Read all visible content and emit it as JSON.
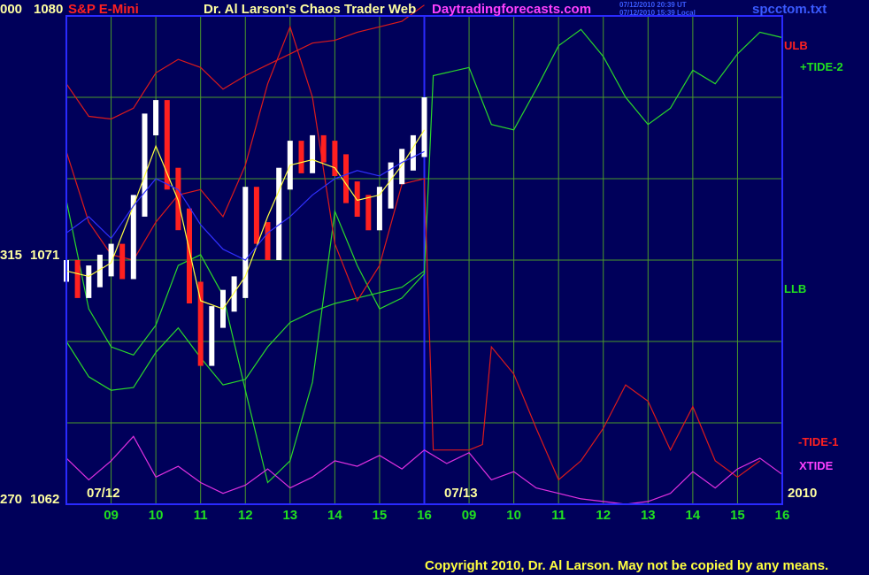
{
  "header": {
    "instrument": "S&P E-Mini",
    "title": "Dr. Al Larson's Chaos Trader Web",
    "site": "Daytradingforecasts.com",
    "timestamp_ut": "07/12/2010 20:39 UT",
    "timestamp_local": "07/12/2010 15:39 Local",
    "filename": "spcctom.txt"
  },
  "y_axis": {
    "top_left": "000",
    "top_price": "1080",
    "mid_left": "315",
    "mid_price": "1071",
    "bottom_left": "270",
    "bottom_price": "1062"
  },
  "right_labels": {
    "ulb": "ULB",
    "tide2": "+TIDE-2",
    "llb": "LLB",
    "tide1": "-TIDE-1",
    "xtide": "XTIDE"
  },
  "date_labels": {
    "d1": "07/12",
    "d2": "07/13",
    "year": "2010"
  },
  "footer": {
    "copyright": "Copyright 2010, Dr. Al Larson. May not be copied by any means."
  },
  "colors": {
    "background": "#00005a",
    "grid": "#4a9a2a",
    "frame": "#2a2aff",
    "ulb": "#dd1a1a",
    "tide2": "#2ad82a",
    "xtide": "#e030e0",
    "bar_up": "#ffffff",
    "bar_down": "#ff2020",
    "ma": "#ffff40",
    "ma_slow": "#3030ff",
    "label_cream": "#ffffa0",
    "label_green": "#20e020",
    "label_red": "#ff2020",
    "label_magenta": "#ff40ff",
    "label_blue": "#3a5aff"
  },
  "chart_data": {
    "type": "line",
    "title": "Dr. Al Larson's Chaos Trader Web",
    "ylim": [
      1062,
      1080
    ],
    "y_ticks": [
      1062,
      1071,
      1080
    ],
    "x_days": [
      "07/12",
      "07/13"
    ],
    "x_ticks": [
      "09",
      "10",
      "11",
      "12",
      "13",
      "14",
      "15",
      "16",
      "09",
      "10",
      "11",
      "12",
      "13",
      "14",
      "15",
      "16"
    ],
    "grid": true,
    "price_bars": {
      "x_hours": [
        8.0,
        8.25,
        8.5,
        8.75,
        9.0,
        9.25,
        9.5,
        9.75,
        10.0,
        10.25,
        10.5,
        10.75,
        11.0,
        11.25,
        11.5,
        11.75,
        12.0,
        12.25,
        12.5,
        12.75,
        13.0,
        13.25,
        13.5,
        13.75,
        14.0,
        14.25,
        14.5,
        14.75,
        15.0,
        15.25,
        15.5,
        15.75,
        16.0
      ],
      "price": [
        1070.6,
        1070.0,
        1070.4,
        1070.8,
        1071.2,
        1070.7,
        1073.0,
        1076.0,
        1076.5,
        1074.0,
        1072.5,
        1069.8,
        1067.5,
        1068.9,
        1069.5,
        1070.0,
        1073.3,
        1072.0,
        1071.4,
        1074.0,
        1075.0,
        1074.6,
        1075.2,
        1075.0,
        1074.5,
        1073.5,
        1073.0,
        1072.5,
        1073.3,
        1074.2,
        1074.7,
        1075.2,
        1076.6
      ]
    },
    "series": [
      {
        "name": "ULB",
        "x_hours": [
          8.0,
          8.5,
          9.0,
          9.5,
          10.0,
          10.5,
          11.0,
          11.5,
          12.0,
          12.5,
          13.0,
          13.5,
          14.0,
          14.5,
          15.0,
          15.5,
          16.0
        ],
        "values": [
          1077.5,
          1076.3,
          1076.2,
          1076.6,
          1077.9,
          1078.4,
          1078.1,
          1077.3,
          1077.8,
          1078.2,
          1078.6,
          1079.0,
          1079.1,
          1079.4,
          1079.6,
          1079.8,
          1080.4
        ]
      },
      {
        "name": "LLB",
        "x_hours": [
          8.0,
          8.5,
          9.0,
          9.5,
          10.0,
          10.5,
          11.0,
          11.5,
          12.0,
          12.5,
          13.0,
          13.5,
          14.0,
          14.5,
          15.0,
          15.5,
          16.0
        ],
        "values": [
          1068.0,
          1066.7,
          1066.2,
          1066.3,
          1067.6,
          1068.5,
          1067.4,
          1066.4,
          1066.6,
          1067.8,
          1068.7,
          1069.1,
          1069.4,
          1069.6,
          1069.8,
          1070.0,
          1070.6
        ]
      },
      {
        "name": "+TIDE-2",
        "x_hours": [
          8.0,
          8.5,
          9.0,
          9.5,
          10.0,
          10.5,
          11.0,
          11.5,
          12.0,
          12.5,
          13.0,
          13.5,
          14.0,
          14.5,
          15.0,
          15.5,
          16.0,
          16.2,
          17.0,
          17.5,
          18.0,
          18.5,
          19.0,
          19.5,
          20.0,
          20.5,
          21.0,
          21.5,
          22.0,
          22.5,
          23.0,
          23.5,
          24.0
        ],
        "values": [
          1073.2,
          1069.2,
          1067.8,
          1067.5,
          1068.6,
          1070.8,
          1071.2,
          1069.7,
          1066.2,
          1062.8,
          1063.6,
          1066.5,
          1072.8,
          1070.8,
          1069.2,
          1069.6,
          1070.5,
          1077.8,
          1078.1,
          1076.0,
          1075.8,
          1077.3,
          1078.9,
          1079.5,
          1078.5,
          1077.0,
          1076.0,
          1076.6,
          1078.0,
          1077.5,
          1078.6,
          1079.4,
          1079.2
        ]
      },
      {
        "name": "-TIDE-1",
        "x_hours": [
          8.0,
          8.5,
          9.0,
          9.5,
          10.0,
          10.5,
          11.0,
          11.5,
          12.0,
          12.5,
          13.0,
          13.5,
          14.0,
          14.5,
          15.0,
          15.5,
          16.0,
          16.2,
          17.0,
          17.3,
          17.5,
          18.0,
          18.5,
          19.0,
          19.5,
          20.0,
          20.5,
          21.0,
          21.5,
          22.0,
          22.5,
          23.0,
          23.5,
          24.0
        ],
        "values": [
          1075.0,
          1072.4,
          1071.2,
          1071.0,
          1072.4,
          1073.4,
          1073.6,
          1072.6,
          1074.5,
          1077.5,
          1079.6,
          1077.0,
          1071.6,
          1069.5,
          1070.8,
          1073.8,
          1074.0,
          1064.0,
          1064.0,
          1064.2,
          1067.8,
          1066.8,
          1064.8,
          1062.9,
          1063.6,
          1064.8,
          1066.4,
          1065.8,
          1064.0,
          1065.6,
          1063.6,
          1063.0,
          1063.6
        ]
      },
      {
        "name": "XTIDE",
        "x_hours": [
          8.0,
          8.5,
          9.0,
          9.5,
          10.0,
          10.5,
          11.0,
          11.5,
          12.0,
          12.5,
          13.0,
          13.5,
          14.0,
          14.5,
          15.0,
          15.5,
          16.0,
          16.5,
          17.0,
          17.5,
          18.0,
          18.5,
          19.0,
          19.5,
          20.0,
          20.5,
          21.0,
          21.5,
          22.0,
          22.5,
          23.0,
          23.5,
          24.0
        ],
        "values": [
          1063.7,
          1062.9,
          1063.6,
          1064.5,
          1063.0,
          1063.4,
          1062.8,
          1062.4,
          1062.7,
          1063.3,
          1062.6,
          1063.0,
          1063.6,
          1063.4,
          1063.8,
          1063.3,
          1064.0,
          1063.5,
          1063.9,
          1062.9,
          1063.2,
          1062.6,
          1062.4,
          1062.2,
          1062.1,
          1062.0,
          1062.1,
          1062.4,
          1063.2,
          1062.6,
          1063.3,
          1063.7,
          1063.1
        ]
      },
      {
        "name": "",
        "x_hours": [
          8.0,
          8.5,
          9.0,
          9.5,
          10.0,
          10.5,
          11.0,
          11.5,
          12.0,
          12.5,
          13.0,
          13.5,
          14.0,
          14.5,
          15.0,
          15.5,
          16.0
        ],
        "values": [
          1070.6,
          1070.4,
          1070.9,
          1073.0,
          1075.2,
          1073.2,
          1069.5,
          1069.2,
          1070.4,
          1072.6,
          1074.5,
          1074.7,
          1074.4,
          1073.2,
          1073.4,
          1074.5,
          1075.8
        ]
      },
      {
        "name": "",
        "x_hours": [
          8.0,
          8.5,
          9.0,
          9.5,
          10.0,
          10.5,
          11.0,
          11.5,
          12.0,
          12.5,
          13.0,
          13.5,
          14.0,
          14.5,
          15.0,
          15.5,
          16.0
        ],
        "values": [
          1072.0,
          1072.6,
          1071.8,
          1073.0,
          1074.0,
          1073.6,
          1072.3,
          1071.4,
          1071.0,
          1072.0,
          1072.6,
          1073.4,
          1074.0,
          1074.3,
          1074.1,
          1074.6,
          1075.0
        ]
      }
    ]
  }
}
